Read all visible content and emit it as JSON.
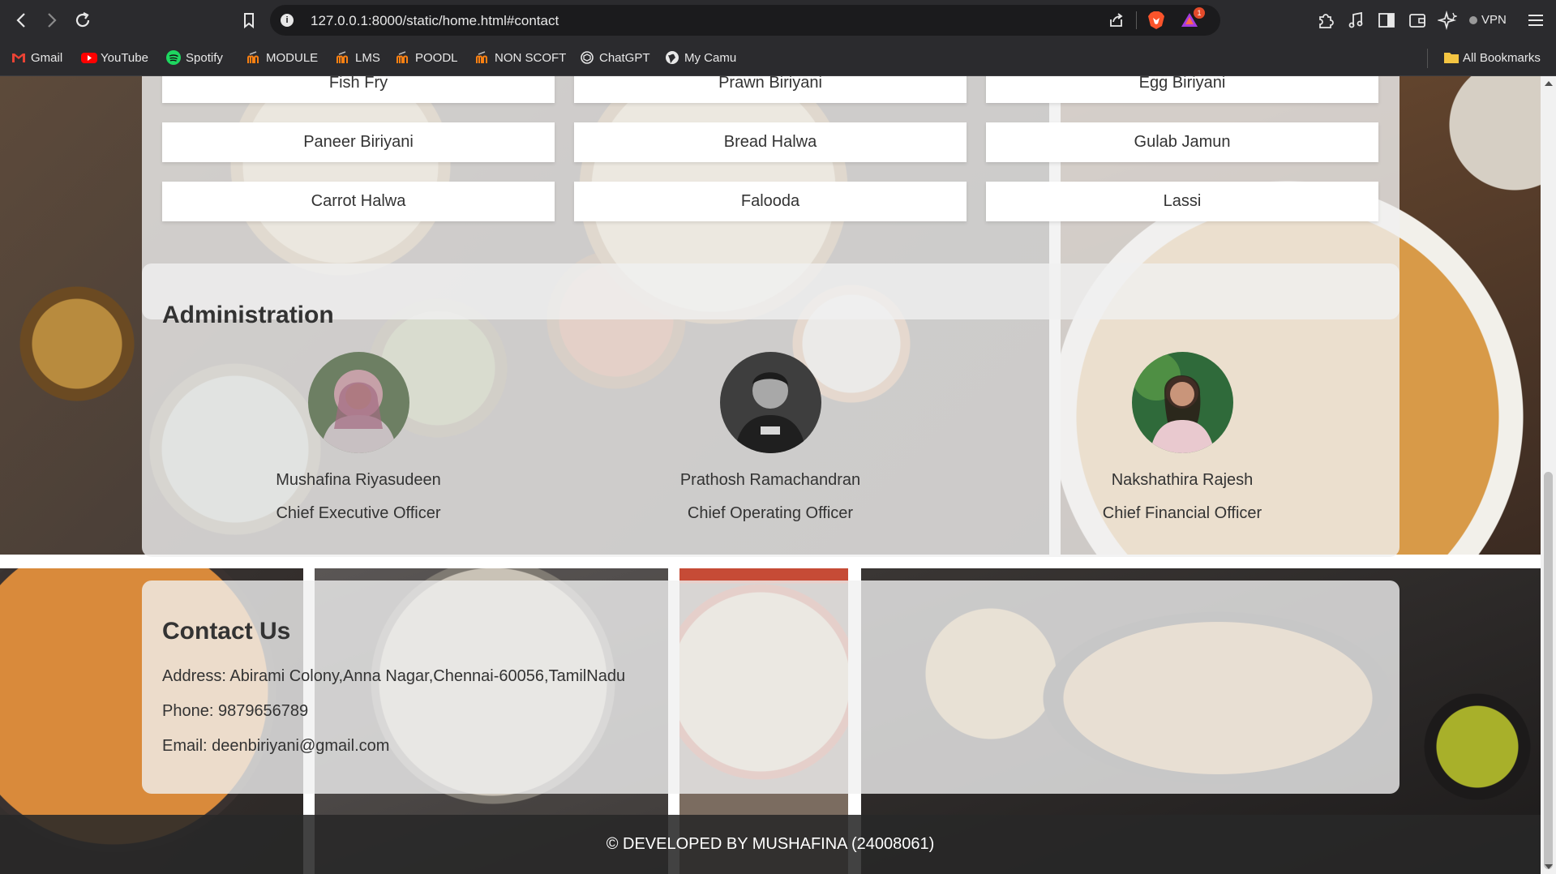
{
  "browser": {
    "url": "127.0.0.1:8000/static/home.html#contact",
    "rewards_badge": "1",
    "vpn_label": "VPN",
    "bookmarks": [
      {
        "label": "Gmail",
        "icon": "gmail-icon"
      },
      {
        "label": "YouTube",
        "icon": "youtube-icon"
      },
      {
        "label": "Spotify",
        "icon": "spotify-icon"
      },
      {
        "label": "MODULE",
        "icon": "moodle-icon"
      },
      {
        "label": "LMS",
        "icon": "moodle-icon"
      },
      {
        "label": "POODL",
        "icon": "moodle-icon"
      },
      {
        "label": "NON SCOFT",
        "icon": "moodle-icon"
      },
      {
        "label": "ChatGPT",
        "icon": "chatgpt-icon"
      },
      {
        "label": "My Camu",
        "icon": "globe-icon"
      }
    ],
    "all_bookmarks": "All Bookmarks"
  },
  "menu": {
    "dishes": [
      "Fish Fry",
      "Prawn Biriyani",
      "Egg Biriyani",
      "Paneer Biriyani",
      "Bread Halwa",
      "Gulab Jamun",
      "Carrot Halwa",
      "Falooda",
      "Lassi"
    ]
  },
  "administration": {
    "title": "Administration",
    "people": [
      {
        "name": "Mushafina Riyasudeen",
        "role": "Chief Executive Officer"
      },
      {
        "name": "Prathosh Ramachandran",
        "role": "Chief Operating Officer"
      },
      {
        "name": "Nakshathira Rajesh",
        "role": "Chief Financial Officer"
      }
    ]
  },
  "contact": {
    "title": "Contact Us",
    "address": "Address: Abirami Colony,Anna Nagar,Chennai-60056,TamilNadu",
    "phone": "Phone: 9879656789",
    "email": "Email: deenbiriyani@gmail.com"
  },
  "footer": {
    "text": "© DEVELOPED BY MUSHAFINA (24008061)"
  }
}
